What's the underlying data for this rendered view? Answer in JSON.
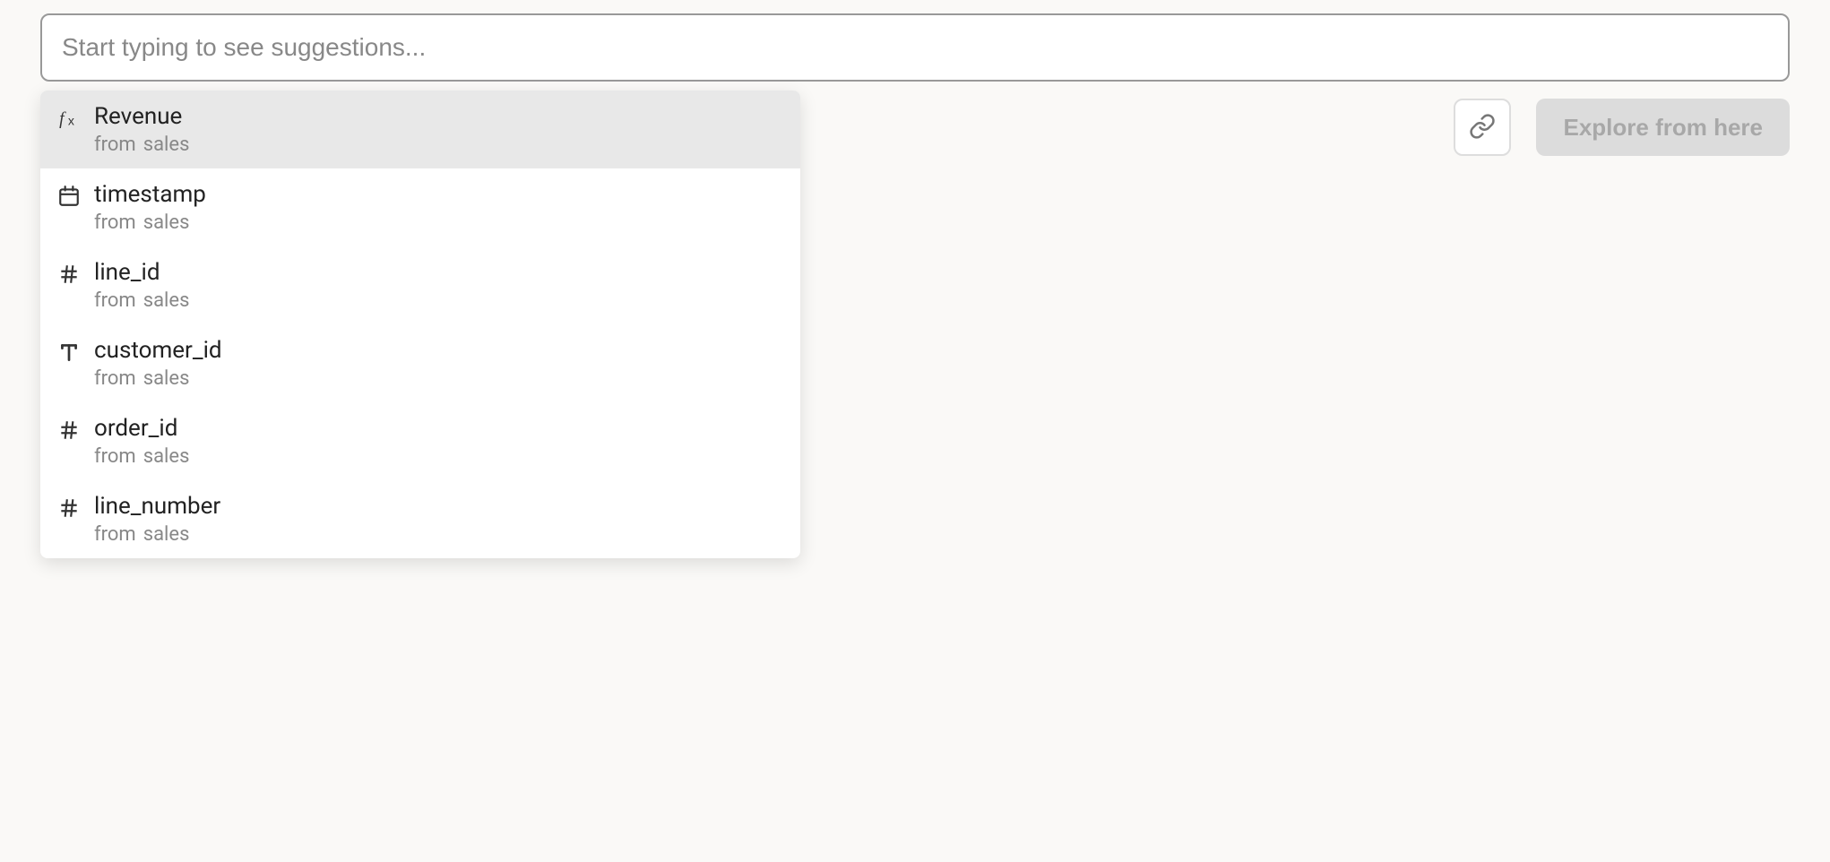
{
  "search": {
    "placeholder": "Start typing to see suggestions...",
    "value": ""
  },
  "toolbar": {
    "explore_label": "Explore from here"
  },
  "suggestions": {
    "from_word": "from",
    "items": [
      {
        "icon": "fx",
        "label": "Revenue",
        "source": "sales",
        "selected": true
      },
      {
        "icon": "calendar",
        "label": "timestamp",
        "source": "sales",
        "selected": false
      },
      {
        "icon": "hash",
        "label": "line_id",
        "source": "sales",
        "selected": false
      },
      {
        "icon": "text",
        "label": "customer_id",
        "source": "sales",
        "selected": false
      },
      {
        "icon": "hash",
        "label": "order_id",
        "source": "sales",
        "selected": false
      },
      {
        "icon": "hash",
        "label": "line_number",
        "source": "sales",
        "selected": false
      }
    ]
  }
}
